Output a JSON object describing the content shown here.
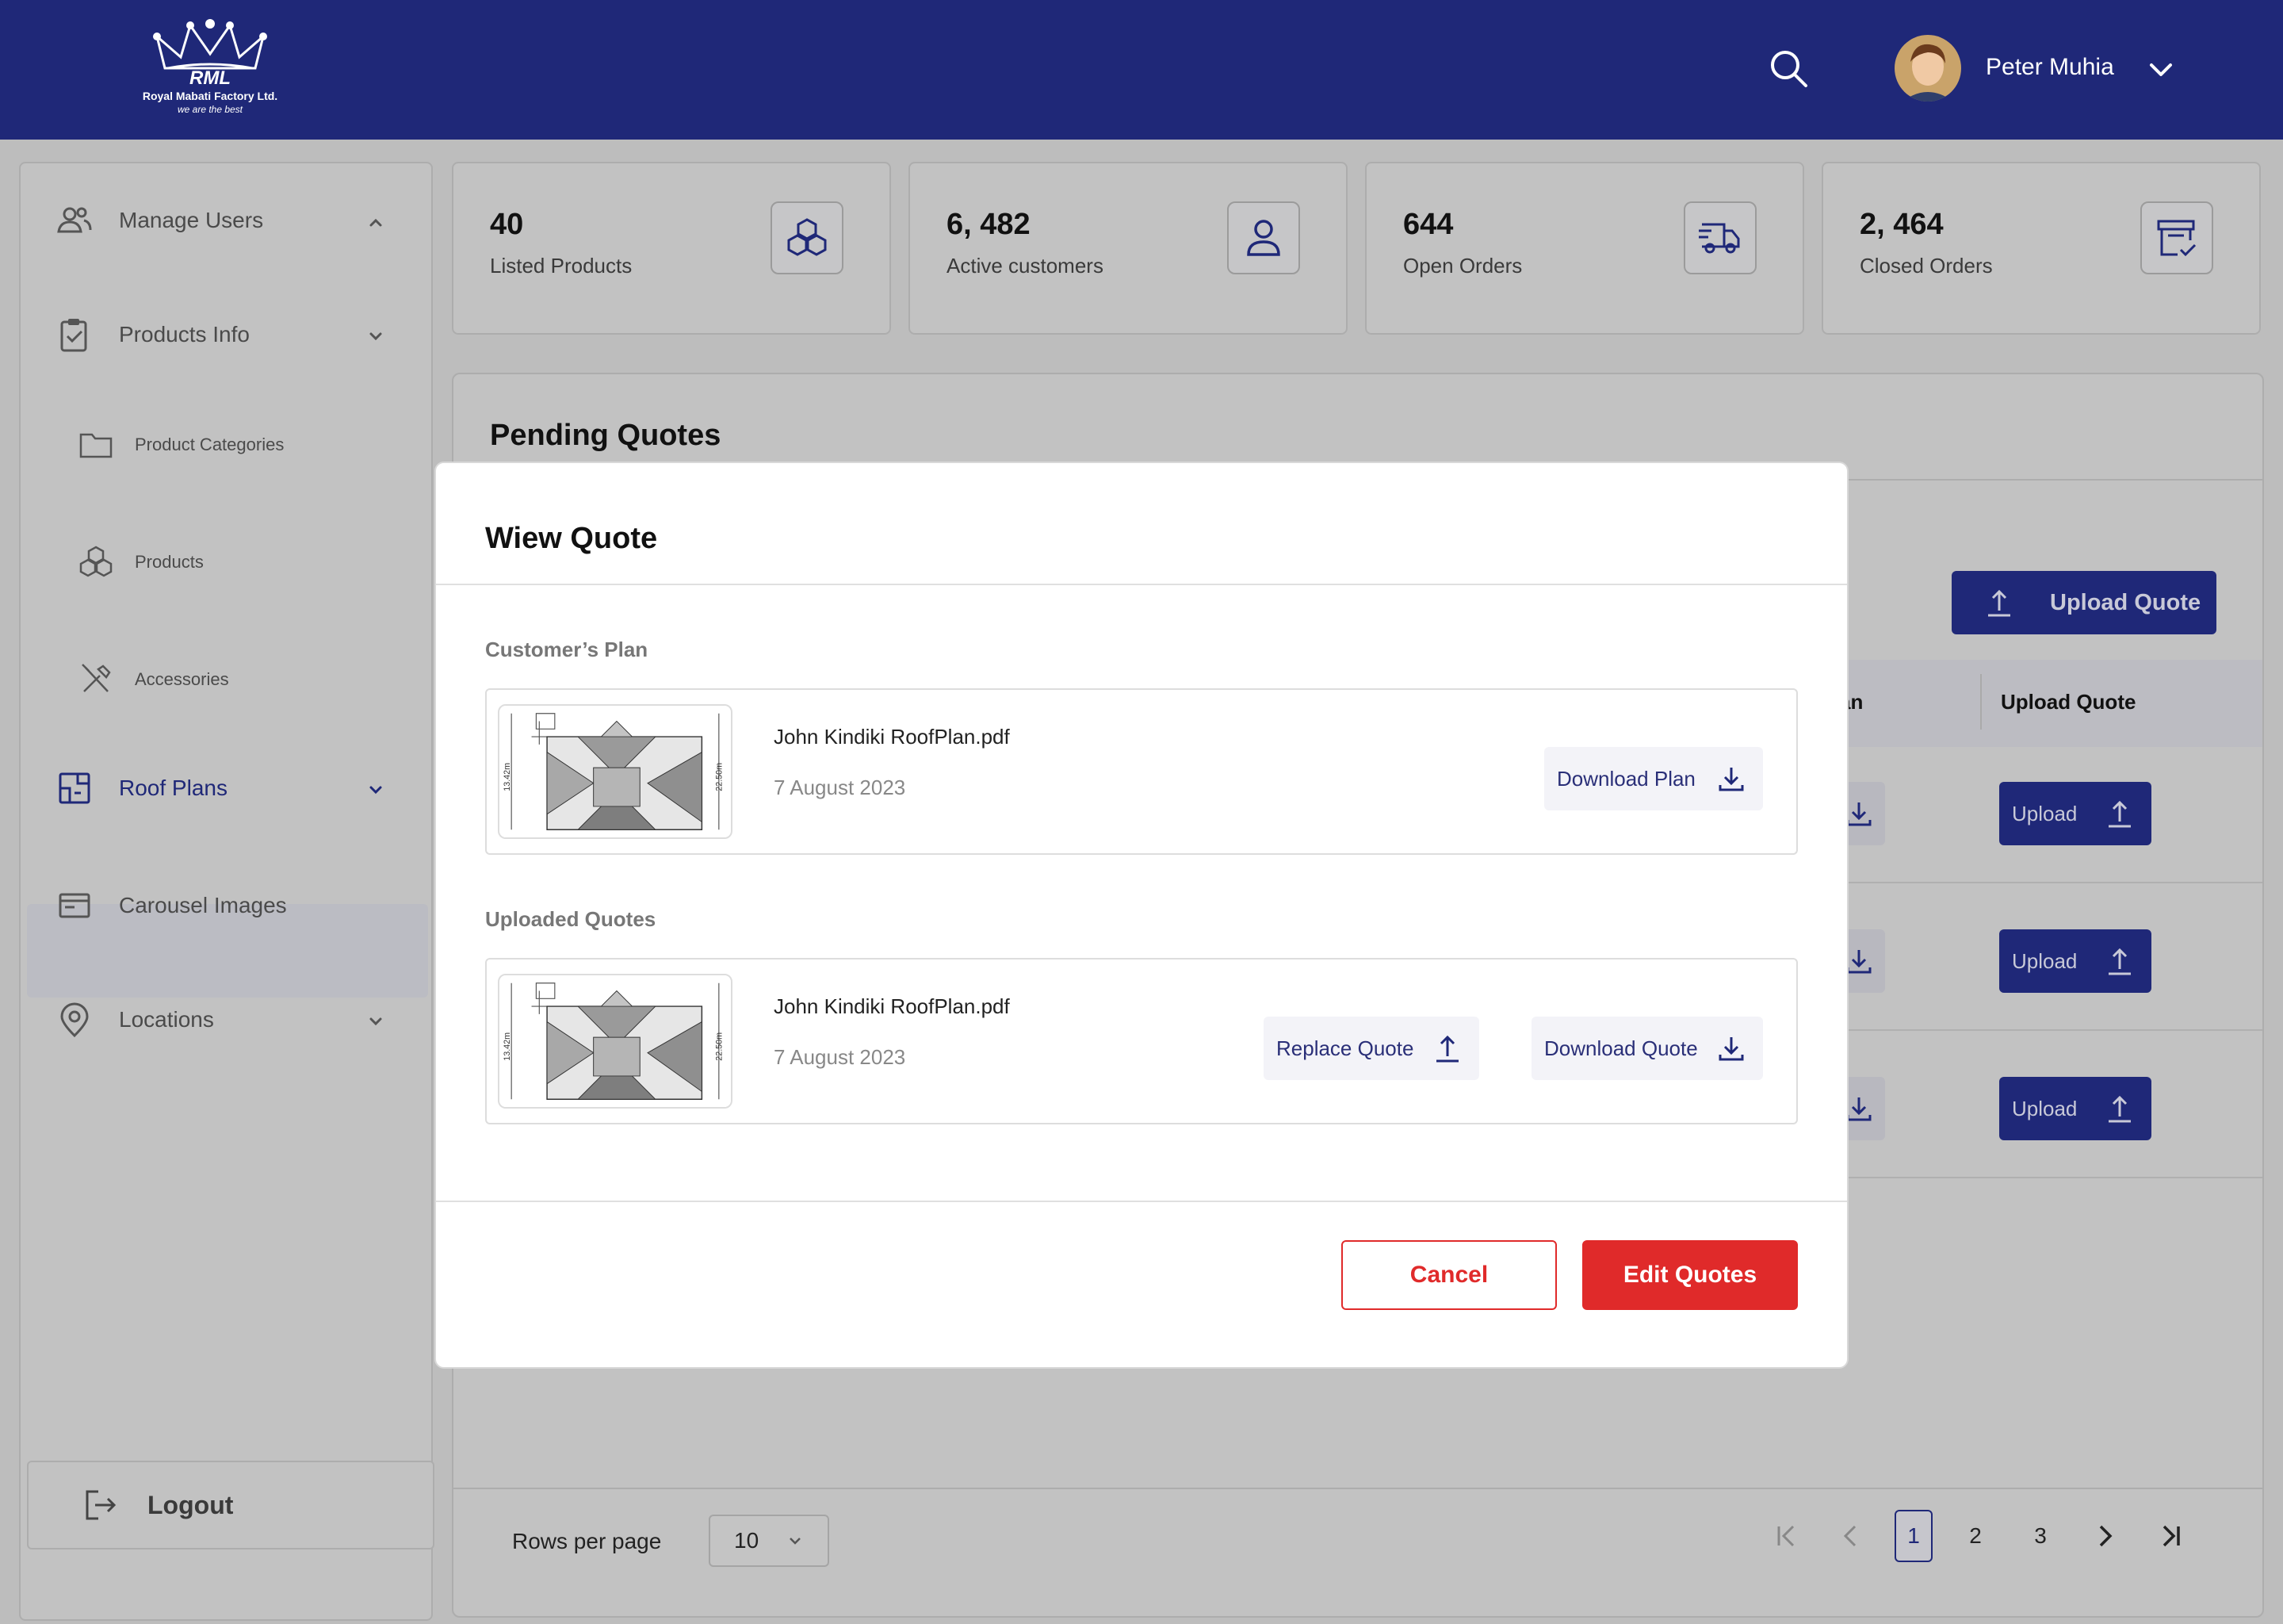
{
  "header": {
    "logo_text": "RML",
    "logo_company": "Royal Mabati Factory Ltd.",
    "logo_tagline": "we are the best",
    "user_name": "Peter Muhia"
  },
  "sidebar": {
    "items": [
      {
        "label": "Manage Users",
        "icon": "users-icon"
      },
      {
        "label": "Products Info",
        "icon": "clipboard-check-icon"
      },
      {
        "label": "Product Categories",
        "icon": "folder-icon"
      },
      {
        "label": "Products",
        "icon": "cubes-icon"
      },
      {
        "label": "Accessories",
        "icon": "tools-icon"
      },
      {
        "label": "Roof Plans",
        "icon": "roof-plan-icon"
      },
      {
        "label": "Carousel Images",
        "icon": "browser-window-icon"
      },
      {
        "label": "Locations",
        "icon": "location-pin-icon"
      }
    ],
    "logout_label": "Logout",
    "active_color": "#1f2878"
  },
  "stats": [
    {
      "value": "40",
      "label": "Listed Products",
      "icon": "cubes-icon"
    },
    {
      "value": "6, 482",
      "label": "Active customers",
      "icon": "user-icon"
    },
    {
      "value": "644",
      "label": "Open Orders",
      "icon": "delivery-truck-icon"
    },
    {
      "value": "2, 464",
      "label": "Closed Orders",
      "icon": "closed-box-icon"
    }
  ],
  "main": {
    "title": "Pending Quotes",
    "upload_quote_button": "Upload Quote",
    "columns": {
      "plan_partial": "an",
      "upload": "Upload Quote"
    },
    "row_upload_label": "Upload",
    "rows_per_page_label": "Rows per page",
    "rows_per_page_value": "10",
    "pages": [
      "1",
      "2",
      "3"
    ],
    "current_page": "1"
  },
  "modal": {
    "title": "Wiew Quote",
    "customer_plan_label": "Customer’s Plan",
    "uploaded_quotes_label": "Uploaded Quotes",
    "plan_file": {
      "name": "John Kindiki RoofPlan.pdf",
      "date": "7 August 2023",
      "download_label": "Download Plan"
    },
    "quote_file": {
      "name": "John Kindiki RoofPlan.pdf",
      "date": "7 August 2023",
      "replace_label": "Replace Quote",
      "download_label": "Download Quote"
    },
    "thumb_dims": {
      "width_label": "13.42m",
      "height_label": "22.50m"
    },
    "cancel_label": "Cancel",
    "edit_label": "Edit Quotes",
    "accent": "#e02a2a"
  }
}
